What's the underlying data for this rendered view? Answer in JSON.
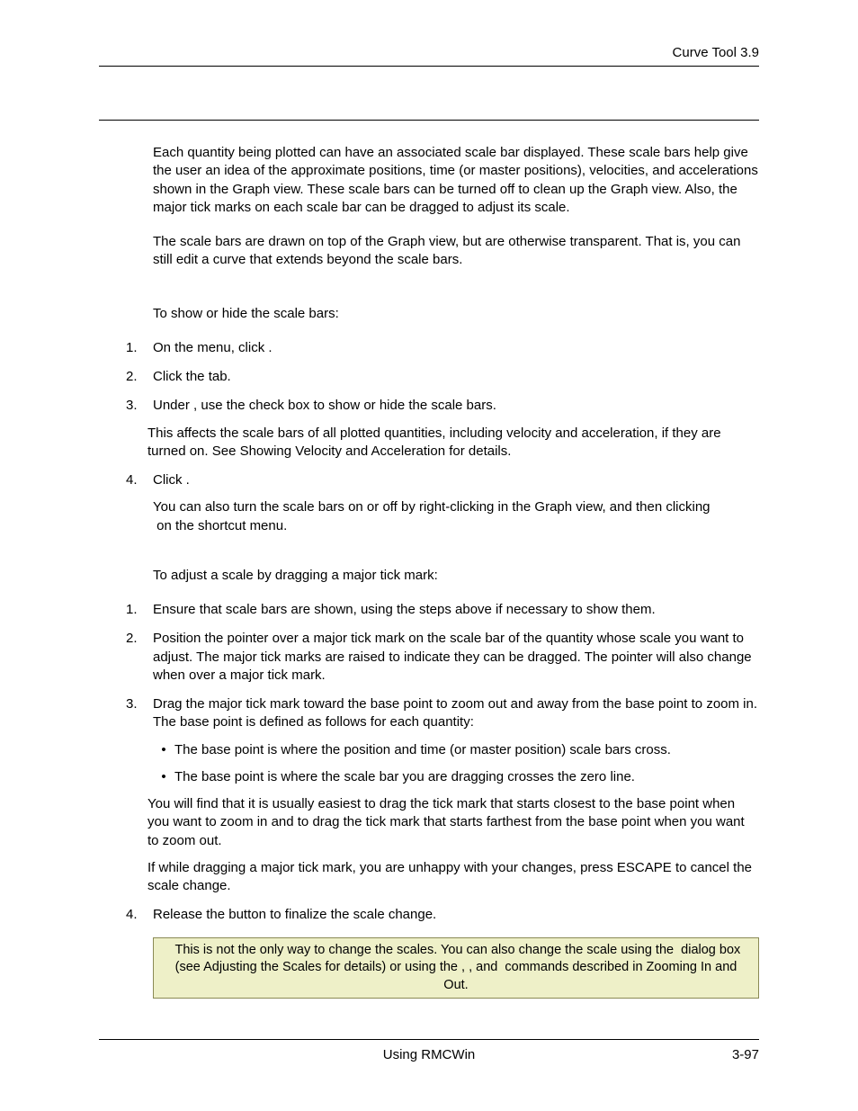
{
  "header": {
    "title": "Curve Tool  3.9"
  },
  "intro": {
    "p1": "Each quantity being plotted can have an associated scale bar displayed. These scale bars help give the user an idea of the approximate positions, time (or master positions), velocities, and accelerations shown in the Graph view. These scale bars can be turned off to clean up the Graph view. Also, the major tick marks on each scale bar can be dragged to adjust its scale.",
    "p2": "The scale bars are drawn on top of the Graph view, but are otherwise transparent. That is, you can still edit a curve that extends beyond the scale bars."
  },
  "show_hide": {
    "lead": "To show or hide the scale bars:",
    "steps": [
      {
        "num": "1.",
        "pre": "On the ",
        "gap1": "        ",
        "mid": "menu, click ",
        "gap2": "              ",
        "post": "."
      },
      {
        "num": "2.",
        "pre": "Click the ",
        "gap1": "          ",
        "mid": "tab.",
        "gap2": "",
        "post": ""
      },
      {
        "num": "3.",
        "pre": "Under ",
        "gap1": "         ",
        "mid": ", use the ",
        "gap2": "                             ",
        "post": "check box to show or hide the scale bars.",
        "follow": "This affects the scale bars of all plotted quantities, including velocity and acceleration, if they are turned on. See Showing Velocity and Acceleration for details."
      },
      {
        "num": "4.",
        "pre": "Click ",
        "gap1": "     ",
        "mid": ".",
        "gap2": "",
        "post": "",
        "follow": "You can also turn the scale bars on or off by right-clicking in the Graph view, and then clicking",
        "follow2_gap": "                                 ",
        "follow2_post": " on the shortcut menu."
      }
    ]
  },
  "adjust": {
    "lead": "To adjust a scale by dragging a major tick mark:",
    "steps": [
      {
        "num": "1.",
        "text": "Ensure that scale bars are shown, using the steps above if necessary to show them."
      },
      {
        "num": "2.",
        "text": "Position the pointer over a major tick mark on the scale bar of the quantity whose scale you want to adjust. The major tick marks are raised to indicate they can be dragged. The pointer will also change when over a major tick mark."
      },
      {
        "num": "3.",
        "text": "Drag the major tick mark toward the base point to zoom out and away from the base point to zoom in. The base point is defined as follows for each quantity:",
        "bullets": [
          {
            "gap": "                                               ",
            "text": "The base point is where the position and time (or master position) scale bars cross."
          },
          {
            "gap": "                                                 ",
            "text": "The base point is where the scale bar you are dragging crosses the zero line."
          }
        ],
        "follow1": "You will find that it is usually easiest to drag the tick mark that starts closest to the base point when you want to zoom in and to drag the tick mark that starts farthest from the base point when you want to zoom out.",
        "follow2": "If while dragging a major tick mark, you are unhappy with your changes, press ESCAPE to cancel the scale change."
      },
      {
        "num": "4.",
        "text": "Release the button to finalize the scale change."
      }
    ]
  },
  "note": {
    "pre": "This is not the only way to change the scales. You can also change the scale using the ",
    "gap1": "          ",
    "mid1": " dialog box (see Adjusting the Scales for details) or using the ",
    "gap2": "                  ",
    "sep1": ", ",
    "gap3": "                  ",
    "sep2": ", and ",
    "gap4": "                  ",
    "post": " commands described in Zooming In and Out."
  },
  "footer": {
    "center": "Using RMCWin",
    "right": "3-97"
  }
}
